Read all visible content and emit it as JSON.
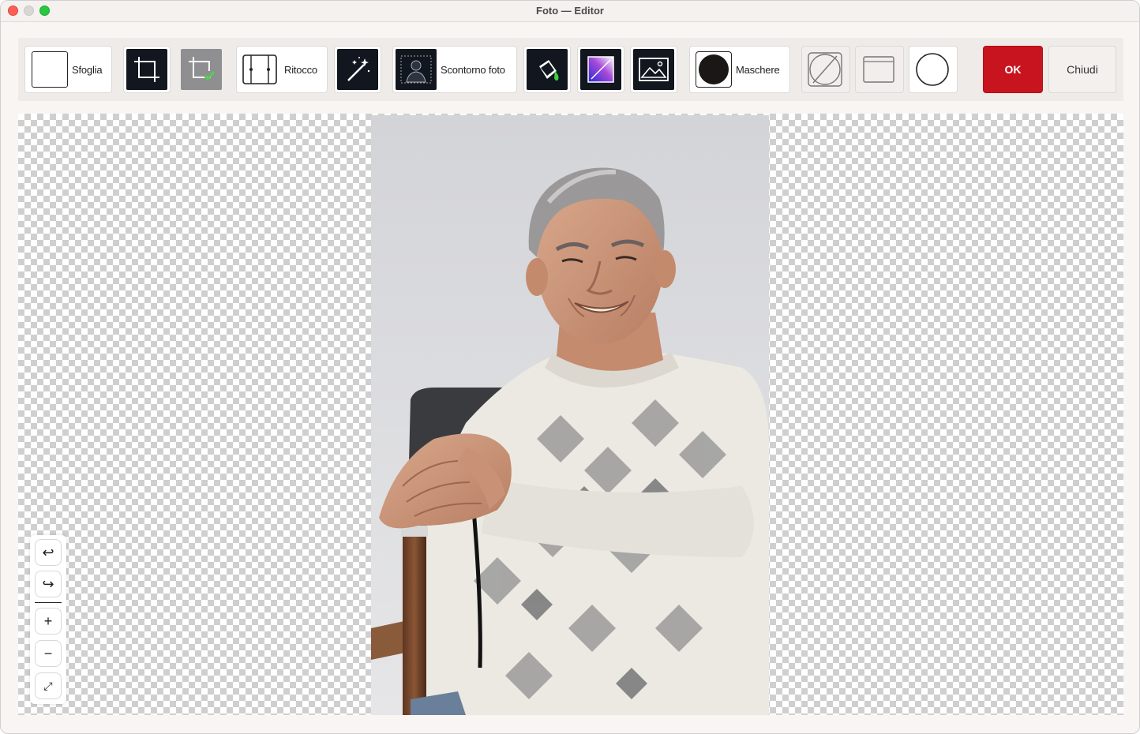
{
  "window": {
    "title": "Foto — Editor"
  },
  "toolbar": {
    "browse_label": "Sfoglia",
    "retouch_label": "Ritocco",
    "cutout_label": "Scontorno foto",
    "masks_label": "Maschere",
    "ok_label": "OK",
    "close_label": "Chiudi"
  },
  "zoom_controls": {
    "undo_icon": "↩",
    "redo_icon": "↪",
    "zoom_in_icon": "+",
    "zoom_out_icon": "−",
    "fit_icon": "⤢"
  },
  "colors": {
    "accent": "#c8141e",
    "tool_dark": "#12161e"
  }
}
